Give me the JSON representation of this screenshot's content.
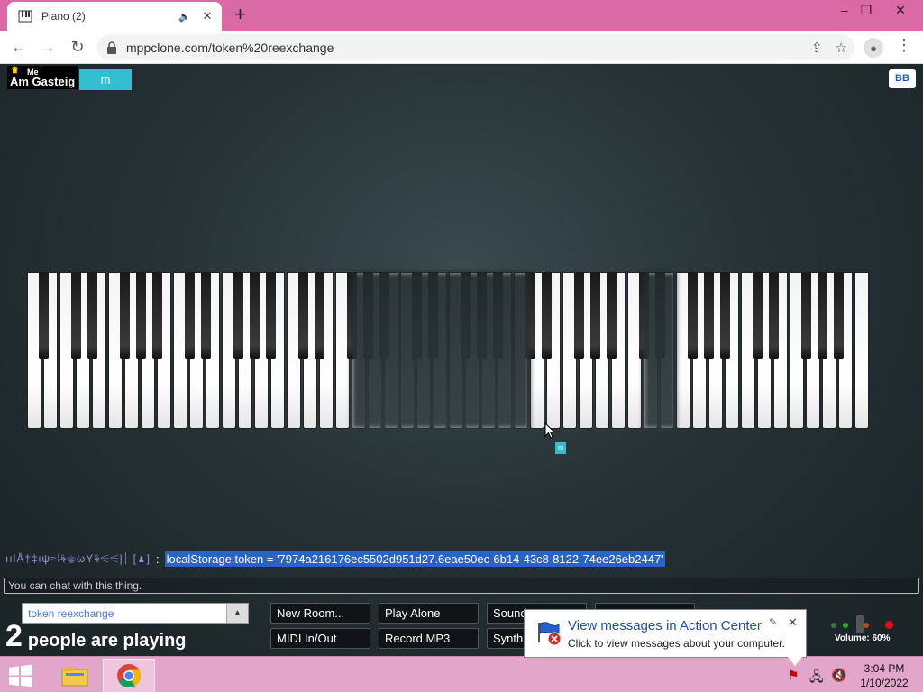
{
  "browser": {
    "tab_title": "Piano (2)",
    "url": "mppclone.com/token%20reexchange",
    "window_controls": {
      "minimize": "–",
      "restore": "❐",
      "close": "✕"
    }
  },
  "page": {
    "me_label": "Me",
    "my_name": "Am Gasteig",
    "other_user": "m",
    "bb_button": "BB",
    "cursor_tag": "m",
    "chat": {
      "sender": "ıılÅ†‡ιψ≈⦚⚘⚜ωΥ⚘⚟⚟|⏐ [♟]",
      "separator": ":",
      "message": "localStorage.token = '7974a216176ec5502d951d27.6eae50ec-6b14-43c8-8122-74ee26eb2447'",
      "input_placeholder": "You can chat with this thing."
    },
    "room": {
      "name": "token reexchange",
      "arrow": "▲"
    },
    "people": {
      "count": "2",
      "text": "people are playing"
    },
    "buttons": {
      "new_room": "New Room...",
      "play_alone": "Play Alone",
      "sound": "Sound",
      "midi": "MIDI In/Out",
      "record": "Record MP3",
      "synth": "Synth"
    },
    "volume_label": "Volume: 60%",
    "volume_level": 0.6
  },
  "popup": {
    "title": "View messages in Action Center",
    "subtitle": "Click to view messages about your computer.",
    "pin": "✎",
    "close": "✕"
  },
  "taskbar": {
    "time": "3:04 PM",
    "date": "1/10/2022"
  },
  "colors": {
    "title_bar": "#d96aa6",
    "taskbar": "#e3a6cb",
    "user_tag": "#34bccf",
    "chat_highlight": "#2a63c7"
  }
}
